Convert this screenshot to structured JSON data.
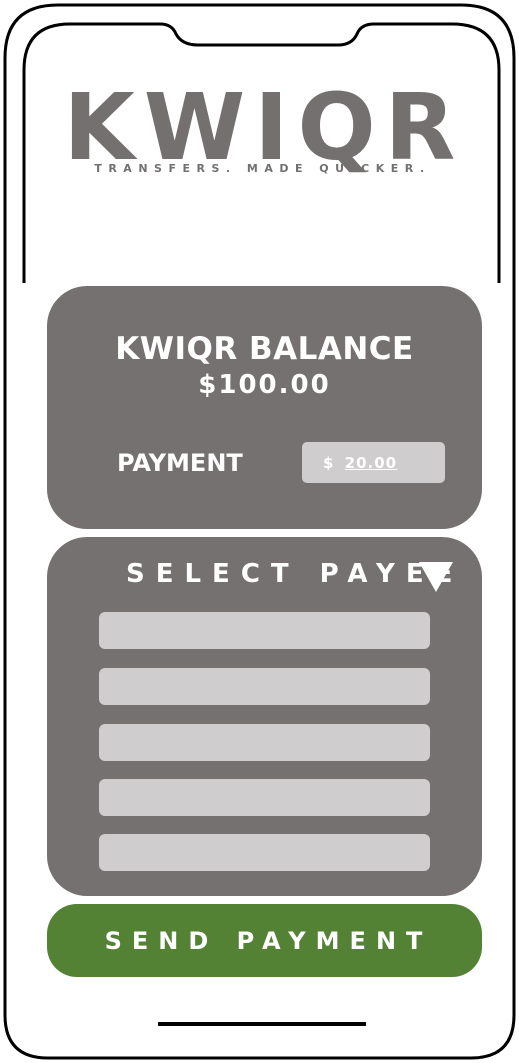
{
  "logo": {
    "wordmark": "KWIQR",
    "tagline": "TRANSFERS. MADE QUICKER."
  },
  "balance": {
    "title": "KWIQR BALANCE",
    "amount": "$100.00"
  },
  "payment": {
    "label": "PAYMENT",
    "currency": "$",
    "value": "20.00"
  },
  "payee": {
    "label": "SELECT PAYEE",
    "arrow_icon": "triangle-down-icon",
    "slots": [
      "",
      "",
      "",
      "",
      ""
    ]
  },
  "actions": {
    "send_label": "SEND PAYMENT"
  },
  "colors": {
    "card": "#757170",
    "field": "#d0cdce",
    "send_button": "#548235",
    "logo": "#747070"
  }
}
